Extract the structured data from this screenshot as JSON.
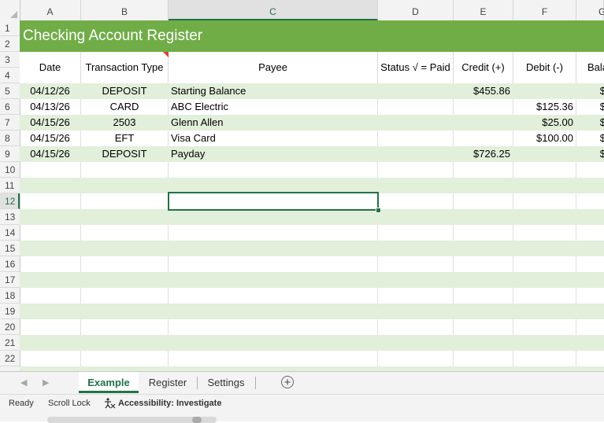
{
  "columns": [
    "A",
    "B",
    "C",
    "D",
    "E",
    "F",
    "G"
  ],
  "selected_column": "C",
  "rows": [
    "1",
    "2",
    "3",
    "4",
    "5",
    "6",
    "7",
    "8",
    "9",
    "10",
    "11",
    "12",
    "13",
    "14",
    "15",
    "16",
    "17",
    "18",
    "19",
    "20",
    "21",
    "22"
  ],
  "selected_row": "12",
  "sheet": {
    "title": "Checking Account Register",
    "headers": [
      "Date",
      "Transaction Type",
      "Payee",
      "Status √ = Paid",
      "Credit (+)",
      "Debit (-)",
      "Balance"
    ],
    "transactions": [
      {
        "date": "04/12/26",
        "type": "DEPOSIT",
        "payee": "Starting Balance",
        "status": "",
        "credit": "$455.86",
        "debit": "",
        "balance": "$"
      },
      {
        "date": "04/13/26",
        "type": "CARD",
        "payee": "ABC Electric",
        "status": "",
        "credit": "",
        "debit": "$125.36",
        "balance": "$"
      },
      {
        "date": "04/15/26",
        "type": "2503",
        "payee": "Glenn Allen",
        "status": "",
        "credit": "",
        "debit": "$25.00",
        "balance": "$"
      },
      {
        "date": "04/15/26",
        "type": "EFT",
        "payee": "Visa Card",
        "status": "",
        "credit": "",
        "debit": "$100.00",
        "balance": "$"
      },
      {
        "date": "04/15/26",
        "type": "DEPOSIT",
        "payee": "Payday",
        "status": "",
        "credit": "$726.25",
        "debit": "",
        "balance": "$"
      }
    ]
  },
  "tabs": [
    "Example",
    "Register",
    "Settings"
  ],
  "active_tab": "Example",
  "add_sheet_icon": "+",
  "status_bar": {
    "ready": "Ready",
    "scroll_lock": "Scroll Lock",
    "accessibility": "Accessibility: Investigate",
    "accessibility_icon": "accessibility-icon"
  },
  "colors": {
    "title_green": "#70ad47",
    "band_green": "#e2efda",
    "excel_green": "#217346"
  }
}
